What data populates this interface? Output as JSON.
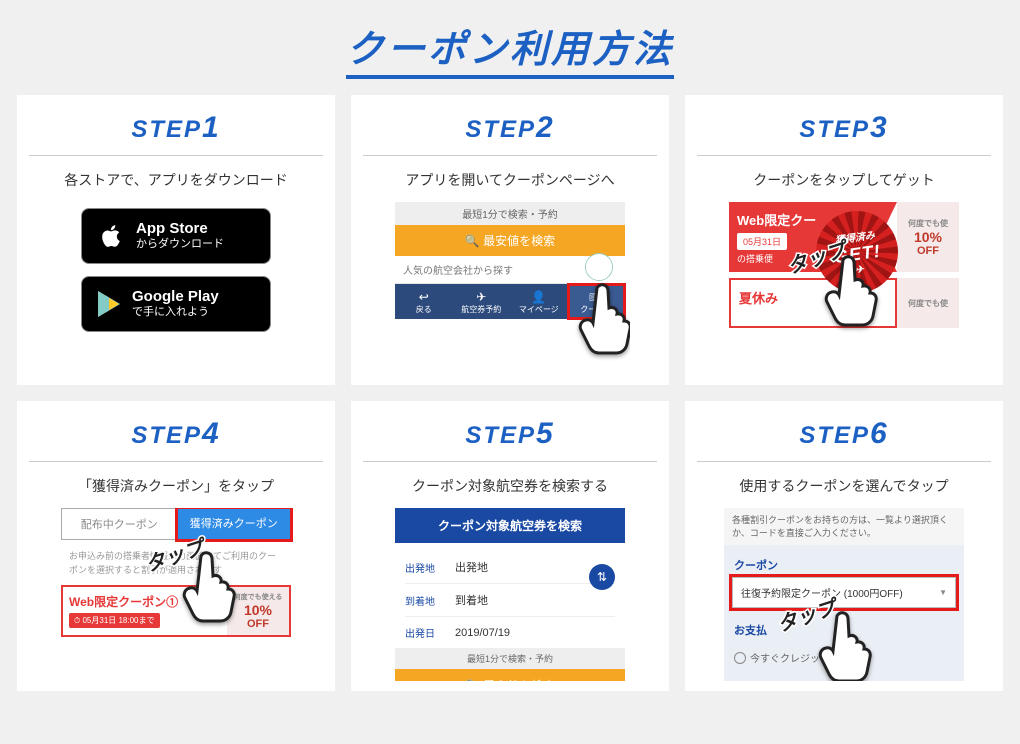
{
  "title": "クーポン利用方法",
  "steps": [
    {
      "label": "STEP",
      "num": "1",
      "desc": "各ストアで、アプリをダウンロード",
      "appstore": {
        "name": "App Store",
        "sub": "からダウンロード"
      },
      "gplay": {
        "name": "Google Play",
        "sub": "で手に入れよう"
      }
    },
    {
      "label": "STEP",
      "num": "2",
      "desc": "アプリを開いてクーポンページへ",
      "head": "最短1分で検索・予約",
      "searchbar": "最安値を検索",
      "cat": "人気の航空会社から探す",
      "nav": [
        "戻る",
        "航空券予約",
        "マイページ",
        "クーポン"
      ]
    },
    {
      "label": "STEP",
      "num": "3",
      "desc": "クーポンをタップしてゲット",
      "tap": "タップ",
      "c_title": "Web限定クー",
      "c_date": "05月31日",
      "c_note": "の搭乗便",
      "c_off_pct": "10%",
      "c_off": "OFF",
      "c_any": "何度でも使",
      "c2_title": "夏休み",
      "badge_top": "獲得済み",
      "badge_main": "GET!"
    },
    {
      "label": "STEP",
      "num": "4",
      "desc": "「獲得済みクーポン」をタップ",
      "tap": "タップ",
      "tab_a": "配布中クーポン",
      "tab_b": "獲得済みクーポン",
      "note": "お申込み前の搭乗者情報入力画面にてご利用のクーポンを選択すると割引が適用されます",
      "c_title": "Web限定クーポン①",
      "c_date": "05月31日 18:00まで",
      "c_any": "何度でも使える",
      "c_off_pct": "10%",
      "c_off": "OFF"
    },
    {
      "label": "STEP",
      "num": "5",
      "desc": "クーポン対象航空券を検索する",
      "hd": "クーポン対象航空券を検索",
      "dep_l": "出発地",
      "dep_v": "出発地",
      "arr_l": "到着地",
      "arr_v": "到着地",
      "date_l": "出発日",
      "date_v": "2019/07/19",
      "foot": "最短1分で検索・予約",
      "btn": "最安値を検索"
    },
    {
      "label": "STEP",
      "num": "6",
      "desc": "使用するクーポンを選んでタップ",
      "tap": "タップ",
      "hd": "各種割引クーポンをお持ちの方は、一覧より選択頂くか、コードを直接ご入力ください。",
      "lbl_coupon": "クーポン",
      "sel": "往復予約限定クーポン (1000円OFF)",
      "lbl_pay": "お支払",
      "radio": "今すぐクレジッ"
    }
  ]
}
